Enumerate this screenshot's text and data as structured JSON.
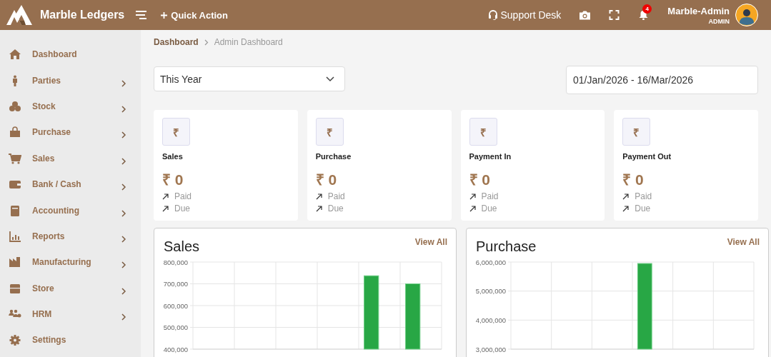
{
  "header": {
    "brand": "Marble Ledgers",
    "quick_action": "Quick Action",
    "support": "Support Desk",
    "notification_count": "4",
    "user_name": "Marble-Admin",
    "user_role": "ADMIN"
  },
  "sidebar": {
    "items": [
      {
        "label": "Dashboard",
        "has_submenu": false
      },
      {
        "label": "Parties",
        "has_submenu": true
      },
      {
        "label": "Stock",
        "has_submenu": true
      },
      {
        "label": "Purchase",
        "has_submenu": true
      },
      {
        "label": "Sales",
        "has_submenu": true
      },
      {
        "label": "Bank / Cash",
        "has_submenu": true
      },
      {
        "label": "Accounting",
        "has_submenu": true
      },
      {
        "label": "Reports",
        "has_submenu": true
      },
      {
        "label": "Manufacturing",
        "has_submenu": true
      },
      {
        "label": "Store",
        "has_submenu": true
      },
      {
        "label": "HRM",
        "has_submenu": true
      },
      {
        "label": "Settings",
        "has_submenu": false
      }
    ]
  },
  "breadcrumb": [
    "Dashboard",
    "Admin Dashboard"
  ],
  "filters": {
    "period": "This Year",
    "date_range": "01/Jan/2026 - 16/Mar/2026"
  },
  "stat_cards": [
    {
      "symbol": "₹",
      "title": "Sales",
      "amount": "₹ 0",
      "lines": [
        "Paid",
        "Due"
      ]
    },
    {
      "symbol": "₹",
      "title": "Purchase",
      "amount": "₹ 0",
      "lines": [
        "Paid",
        "Due"
      ]
    },
    {
      "symbol": "₹",
      "title": "Payment In",
      "amount": "₹ 0",
      "lines": [
        "Paid",
        "Due"
      ]
    },
    {
      "symbol": "₹",
      "title": "Payment Out",
      "amount": "₹ 0",
      "lines": [
        "Paid",
        "Due"
      ]
    }
  ],
  "charts": [
    {
      "title": "Sales",
      "link": "View All",
      "chart_data": {
        "type": "bar",
        "values": [
          null,
          null,
          null,
          null,
          737000,
          700000
        ],
        "grid": true,
        "ylim": [
          400000,
          800000
        ],
        "yticks": [
          {
            "value": 400000,
            "label": "400,000"
          },
          {
            "value": 500000,
            "label": "500,000"
          },
          {
            "value": 600000,
            "label": "600,000"
          },
          {
            "value": 700000,
            "label": "700,000"
          },
          {
            "value": 800000,
            "label": "800,000"
          }
        ]
      }
    },
    {
      "title": "Purchase",
      "link": "View All",
      "chart_data": {
        "type": "bar",
        "values": [
          null,
          null,
          null,
          5950000,
          null,
          null
        ],
        "grid": true,
        "ylim": [
          3000000,
          6000000
        ],
        "yticks": [
          {
            "value": 3000000,
            "label": "3,000,000"
          },
          {
            "value": 4000000,
            "label": "4,000,000"
          },
          {
            "value": 5000000,
            "label": "5,000,000"
          },
          {
            "value": 6000000,
            "label": "6,000,000"
          }
        ]
      }
    }
  ]
}
